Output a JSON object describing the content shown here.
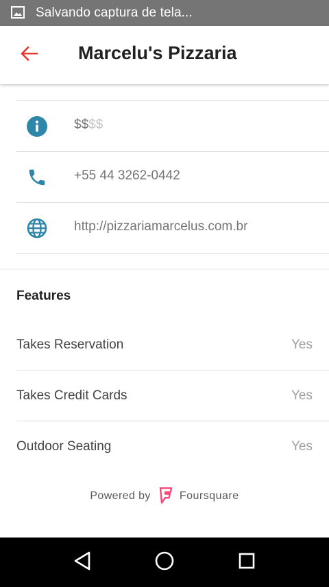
{
  "status_bar": {
    "icon": "image-icon",
    "text": "Salvando captura de tela..."
  },
  "app_bar": {
    "back_icon": "arrow-back-icon",
    "title": "Marcelu's Pizzaria",
    "accent_color": "#e53935"
  },
  "details": {
    "price": {
      "icon": "info-icon",
      "active": "$$",
      "inactive": "$$"
    },
    "phone": {
      "icon": "phone-icon",
      "value": "+55 44 3262-0442"
    },
    "website": {
      "icon": "globe-icon",
      "value": "http://pizzariamarcelus.com.br"
    },
    "icon_color": "#2e86a8"
  },
  "features": {
    "title": "Features",
    "items": [
      {
        "name": "Takes Reservation",
        "value": "Yes"
      },
      {
        "name": "Takes Credit Cards",
        "value": "Yes"
      },
      {
        "name": "Outdoor Seating",
        "value": "Yes"
      }
    ]
  },
  "attribution": {
    "prefix": "Powered by",
    "brand": "Foursquare",
    "logo_icon": "foursquare-logo-icon",
    "brand_color": "#f94877"
  },
  "nav_bar": {
    "back_icon": "nav-back-triangle-icon",
    "home_icon": "nav-home-circle-icon",
    "recents_icon": "nav-recents-square-icon"
  }
}
